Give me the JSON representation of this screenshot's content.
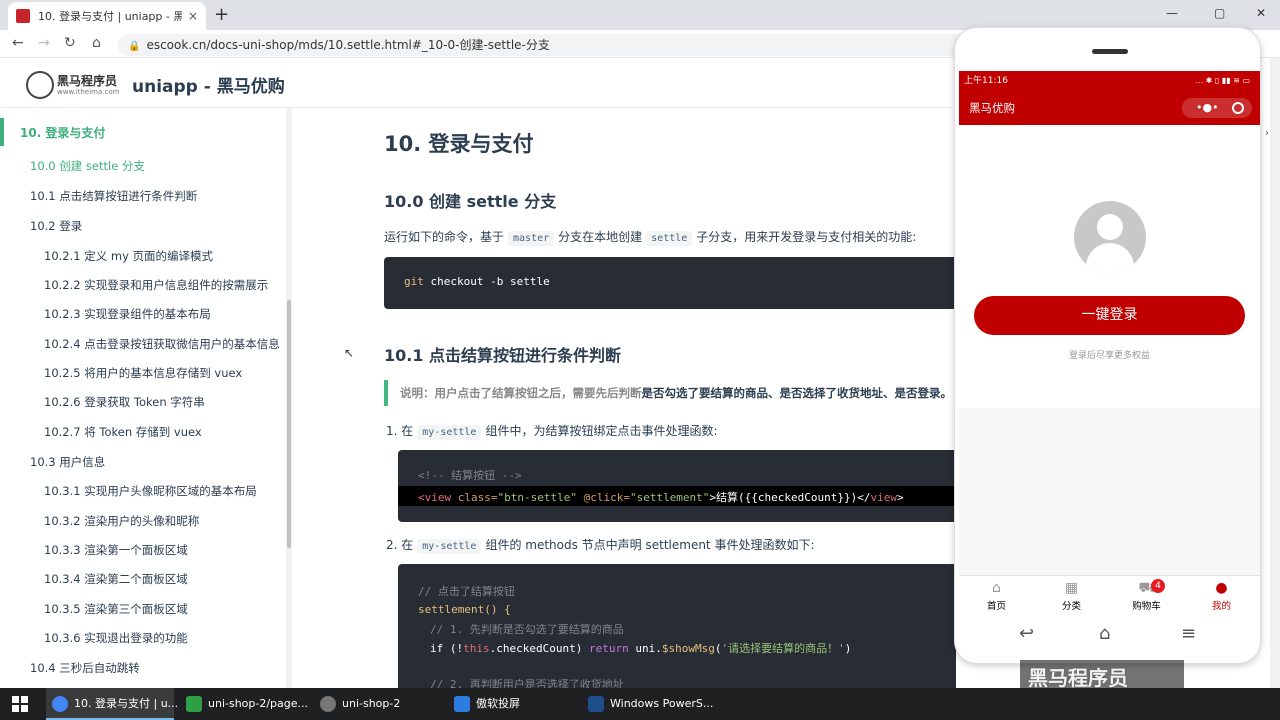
{
  "browser": {
    "tab_title": "10. 登录与支付 | uniapp - 黑马...",
    "tab_close": "×",
    "new_tab": "+",
    "url": "escook.cn/docs-uni-shop/mds/10.settle.html#_10-0-创建-settle-分支"
  },
  "site": {
    "logo_text": "黑马程序员",
    "logo_sub": "www.itheima.com",
    "title": "uniapp - 黑马优购"
  },
  "sidebar": {
    "items": [
      {
        "label": "10. 登录与支付"
      },
      {
        "label": "10.0 创建 settle 分支"
      },
      {
        "label": "10.1 点击结算按钮进行条件判断"
      },
      {
        "label": "10.2 登录"
      },
      {
        "label": "10.2.1 定义 my 页面的编译模式"
      },
      {
        "label": "10.2.2 实现登录和用户信息组件的按需展示"
      },
      {
        "label": "10.2.3 实现登录组件的基本布局"
      },
      {
        "label": "10.2.4 点击登录按钮获取微信用户的基本信息"
      },
      {
        "label": "10.2.5 将用户的基本信息存储到 vuex"
      },
      {
        "label": "10.2.6 登录获取 Token 字符串"
      },
      {
        "label": "10.2.7 将 Token 存储到 vuex"
      },
      {
        "label": "10.3 用户信息"
      },
      {
        "label": "10.3.1 实现用户头像昵称区域的基本布局"
      },
      {
        "label": "10.3.2 渲染用户的头像和昵称"
      },
      {
        "label": "10.3.3 渲染第一个面板区域"
      },
      {
        "label": "10.3.4 渲染第二个面板区域"
      },
      {
        "label": "10.3.5 渲染第三个面板区域"
      },
      {
        "label": "10.3.6 实现退出登录的功能"
      },
      {
        "label": "10.4 三秒后自动跳转"
      }
    ]
  },
  "content": {
    "h1": "10. 登录与支付",
    "h2_0": "10.0 创建 settle 分支",
    "p0_a": "运行如下的命令，基于",
    "p0_code1": "master",
    "p0_b": "分支在本地创建",
    "p0_code2": "settle",
    "p0_c": "子分支，用来开发登录与支付相关的功能:",
    "cmd_git": "git",
    "cmd_rest": " checkout -b settle",
    "h2_1": "10.1 点击结算按钮进行条件判断",
    "tip_a": "说明：用户点击了结算按钮之后，需要先后判断",
    "tip_b": "是否勾选了要结算的商品、是否选择了收货地址、是否登录。",
    "step1_a": "1. 在",
    "step1_code": "my-settle",
    "step1_b": "组件中，为结算按钮绑定点击事件处理函数:",
    "code1_l1": "<!-- 结算按钮 -->",
    "code1_l2_tag": "<view",
    "code1_l2_attr1": " class=",
    "code1_l2_val1": "\"btn-settle\"",
    "code1_l2_attr2": " @click=",
    "code1_l2_val2": "\"settlement\"",
    "code1_l2_text": ">结算({{checkedCount}})</",
    "code1_l2_close": "view",
    "code1_l2_end": ">",
    "step2_a": "2. 在",
    "step2_code": "my-settle",
    "step2_b": "组件的 methods 节点中声明 settlement 事件处理函数如下:",
    "code2_l1": "// 点击了结算按钮",
    "code2_l2": "settlement() {",
    "code2_l3": "// 1. 先判断是否勾选了要结算的商品",
    "code2_l4_a": "if (!",
    "code2_l4_this": "this",
    "code2_l4_b": ".checkedCount) ",
    "code2_l4_ret": "return",
    "code2_l4_c": " uni.",
    "code2_l4_fn": "$showMsg",
    "code2_l4_d": "(",
    "code2_l4_str": "'请选择要结算的商品！'",
    "code2_l4_e": ")",
    "code2_l5": "// 2. 再判断用户是否选择了收货地址"
  },
  "phone": {
    "status_time": "上午11:16",
    "status_icons": "... ✱ ▯ ▮▮ ≋ ▭",
    "nav_title": "黑马优购",
    "capsule_dots": "•●•",
    "login_button": "一键登录",
    "login_tip": "登录后尽享更多权益",
    "tabs": [
      {
        "label": "首页",
        "icon": "⌂"
      },
      {
        "label": "分类",
        "icon": "▦"
      },
      {
        "label": "购物车",
        "icon": "⛟"
      },
      {
        "label": "我的",
        "icon": "●"
      }
    ],
    "cart_badge": "4",
    "sys_back": "↩",
    "sys_home": "⌂",
    "sys_menu": "≡"
  },
  "watermark": "黑马程序员",
  "taskbar": {
    "items": [
      {
        "label": "10. 登录与支付 | u..."
      },
      {
        "label": "uni-shop-2/page..."
      },
      {
        "label": "uni-shop-2"
      },
      {
        "label": "傲软投屏"
      },
      {
        "label": "Windows PowerS..."
      }
    ]
  },
  "colors": {
    "accent": "#3eaf7c",
    "brand_red": "#c00000",
    "code_bg": "#282c34"
  }
}
